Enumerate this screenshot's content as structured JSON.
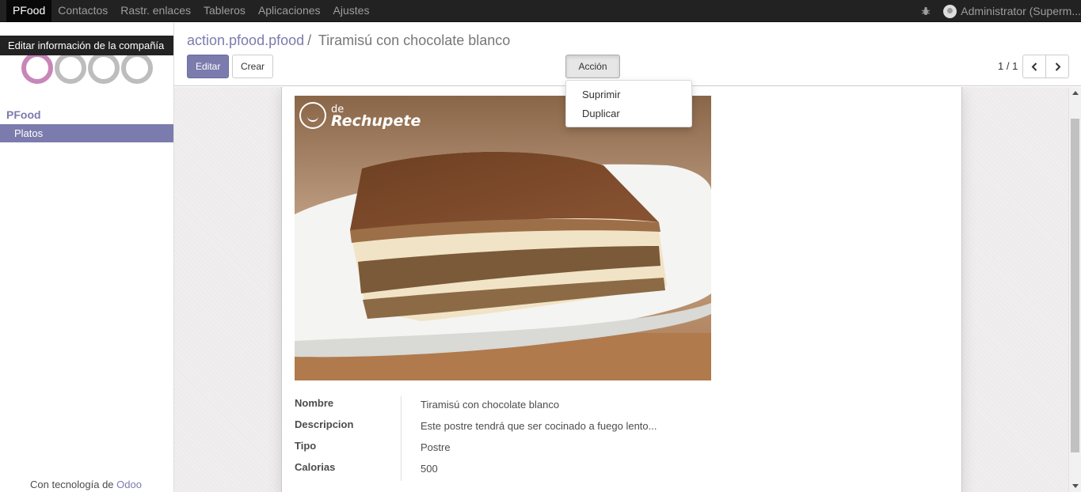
{
  "navbar": {
    "apps": [
      "PFood",
      "Contactos",
      "Rastr. enlaces",
      "Tableros",
      "Aplicaciones",
      "Ajustes"
    ],
    "active_app": "PFood",
    "user_name": "Administrator (Superm..."
  },
  "sidebar": {
    "tooltip": "Editar información de la compañía",
    "section": "PFood",
    "items": [
      {
        "label": "Platos",
        "active": true
      }
    ],
    "powered_by_prefix": "Con tecnología de",
    "powered_by_brand": "Odoo"
  },
  "control_panel": {
    "breadcrumb_link": "action.pfood.pfood",
    "breadcrumb_sep": "/",
    "breadcrumb_current": "Tiramisú con chocolate blanco",
    "edit_label": "Editar",
    "create_label": "Crear",
    "action_label": "Acción",
    "pager_value": "1 / 1"
  },
  "action_menu": {
    "items": [
      "Suprimir",
      "Duplicar"
    ]
  },
  "record": {
    "image_watermark_line1": "de",
    "image_watermark_line2": "Rechupete",
    "fields": [
      {
        "label": "Nombre",
        "value": "Tiramisú con chocolate blanco"
      },
      {
        "label": "Descripcion",
        "value": "Este postre tendrá que ser cocinado a fuego lento..."
      },
      {
        "label": "Tipo",
        "value": "Postre"
      },
      {
        "label": "Calorias",
        "value": "500"
      }
    ]
  },
  "colors": {
    "brand": "#7c7bad",
    "navbar": "#222222"
  }
}
